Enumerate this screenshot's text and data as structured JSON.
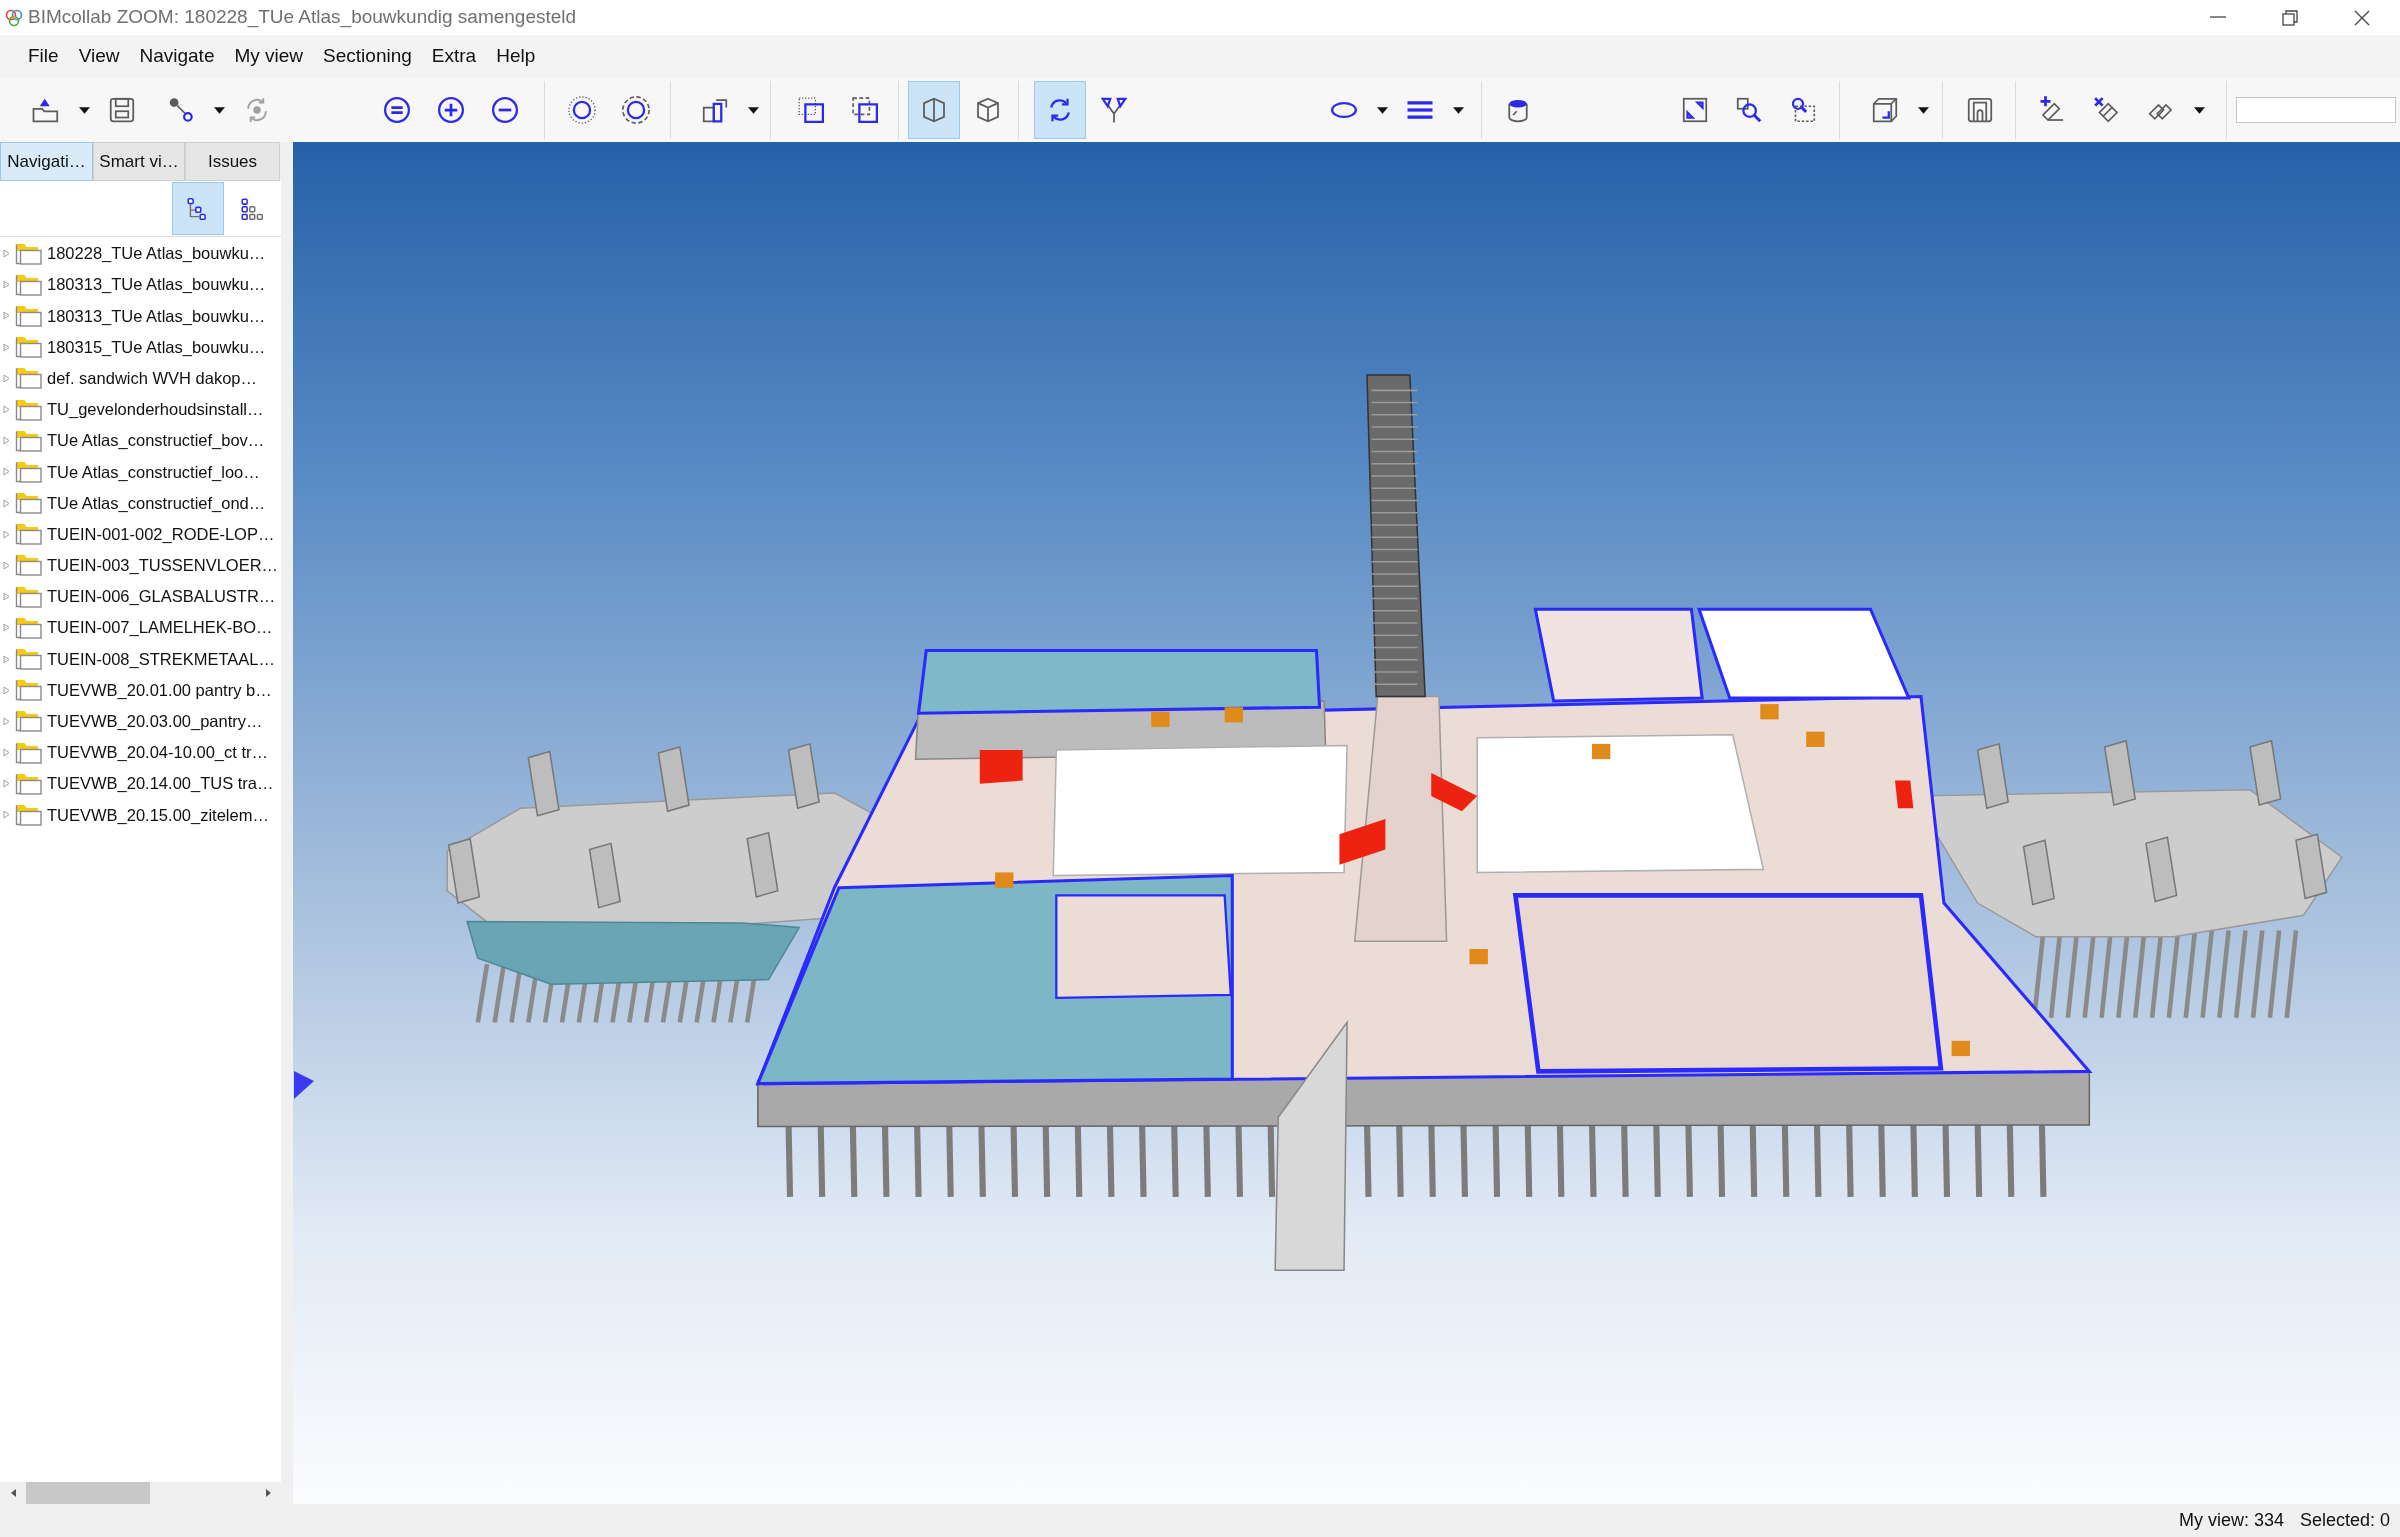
{
  "window": {
    "title": "BIMcollab ZOOM: 180228_TUe Atlas_bouwkundig samengesteld"
  },
  "menu": [
    "File",
    "View",
    "Navigate",
    "My view",
    "Sectioning",
    "Extra",
    "Help"
  ],
  "toolbar": {
    "groups": [
      [
        {
          "selected": false,
          "dropdown": true
        },
        {
          "selected": false,
          "dropdown": false
        }
      ],
      [
        {
          "selected": false,
          "dropdown": true
        },
        {
          "selected": false,
          "dropdown": false
        }
      ],
      [
        {
          "selected": false,
          "dropdown": false
        },
        {
          "selected": false,
          "dropdown": false
        },
        {
          "selected": false,
          "dropdown": false
        }
      ],
      [
        {
          "selected": false,
          "dropdown": false
        },
        {
          "selected": false,
          "dropdown": false
        }
      ],
      [
        {
          "selected": false,
          "dropdown": true
        }
      ],
      [
        {
          "selected": false,
          "dropdown": false
        },
        {
          "selected": false,
          "dropdown": false
        }
      ],
      [
        {
          "selected": true,
          "dropdown": false
        },
        {
          "selected": false,
          "dropdown": false
        }
      ],
      [
        {
          "selected": true,
          "dropdown": false
        },
        {
          "selected": false,
          "dropdown": false
        }
      ],
      [
        {
          "selected": false,
          "dropdown": true
        },
        {
          "selected": false,
          "dropdown": true
        }
      ],
      [
        {
          "selected": false,
          "dropdown": false
        }
      ],
      [
        {
          "selected": false,
          "dropdown": false
        },
        {
          "selected": false,
          "dropdown": false
        },
        {
          "selected": false,
          "dropdown": false
        }
      ],
      [
        {
          "selected": false,
          "dropdown": true
        }
      ],
      [
        {
          "selected": false,
          "dropdown": false
        }
      ],
      [
        {
          "selected": false,
          "dropdown": false
        },
        {
          "selected": false,
          "dropdown": false
        },
        {
          "selected": false,
          "dropdown": true
        }
      ]
    ]
  },
  "sidebar": {
    "tabs": [
      {
        "label": "Navigati…",
        "selected": true
      },
      {
        "label": "Smart vi…",
        "selected": false
      },
      {
        "label": "Issues",
        "selected": false
      }
    ],
    "view_buttons": [
      {
        "selected": true
      },
      {
        "selected": false
      }
    ],
    "tree": [
      {
        "label": "180228_TUe Atlas_bouwku…",
        "expanded": false
      },
      {
        "label": "180313_TUe Atlas_bouwku…",
        "expanded": false
      },
      {
        "label": "180313_TUe Atlas_bouwku…",
        "expanded": false
      },
      {
        "label": "180315_TUe Atlas_bouwku…",
        "expanded": false
      },
      {
        "label": "def. sandwich WVH dakop…",
        "expanded": false
      },
      {
        "label": "TU_gevelonderhoudsinstall…",
        "expanded": false
      },
      {
        "label": "TUe Atlas_constructief_bov…",
        "expanded": false
      },
      {
        "label": "TUe Atlas_constructief_loo…",
        "expanded": false
      },
      {
        "label": "TUe Atlas_constructief_ond…",
        "expanded": false
      },
      {
        "label": "TUEIN-001-002_RODE-LOP…",
        "expanded": false
      },
      {
        "label": "TUEIN-003_TUSSENVLOER…",
        "expanded": false
      },
      {
        "label": "TUEIN-006_GLASBALUSTR…",
        "expanded": false
      },
      {
        "label": "TUEIN-007_LAMELHEK-BO…",
        "expanded": false
      },
      {
        "label": "TUEIN-008_STREKMETAAL…",
        "expanded": false
      },
      {
        "label": "TUEVWB_20.01.00 pantry b…",
        "expanded": false
      },
      {
        "label": "TUEVWB_20.03.00_pantry…",
        "expanded": false
      },
      {
        "label": "TUEVWB_20.04-10.00_ct tr…",
        "expanded": false
      },
      {
        "label": "TUEVWB_20.14.00_TUS tra…",
        "expanded": false
      },
      {
        "label": "TUEVWB_20.15.00_zitelem…",
        "expanded": false
      }
    ]
  },
  "status_bar": {
    "items": [
      "My view: 334",
      "Selected: 0"
    ]
  }
}
